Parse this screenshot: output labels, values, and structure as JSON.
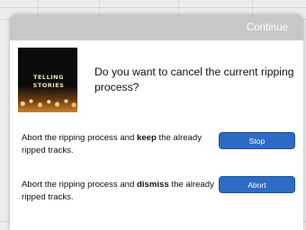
{
  "header": {
    "continue_label": "Continue"
  },
  "album": {
    "line1": "TELLING",
    "line2": "STORIES"
  },
  "dialog": {
    "question": "Do you want to cancel the current ripping process?"
  },
  "options": [
    {
      "text_before": "Abort the ripping process and ",
      "emphasis": "keep",
      "text_after": " the already ripped tracks.",
      "button_label": "Stop"
    },
    {
      "text_before": "Abort the ripping process and ",
      "emphasis": "dismiss",
      "text_after": " the already ripped tracks.",
      "button_label": "Abort"
    }
  ],
  "colors": {
    "header": "#c7c7c7",
    "button": "#2d6cc4"
  }
}
